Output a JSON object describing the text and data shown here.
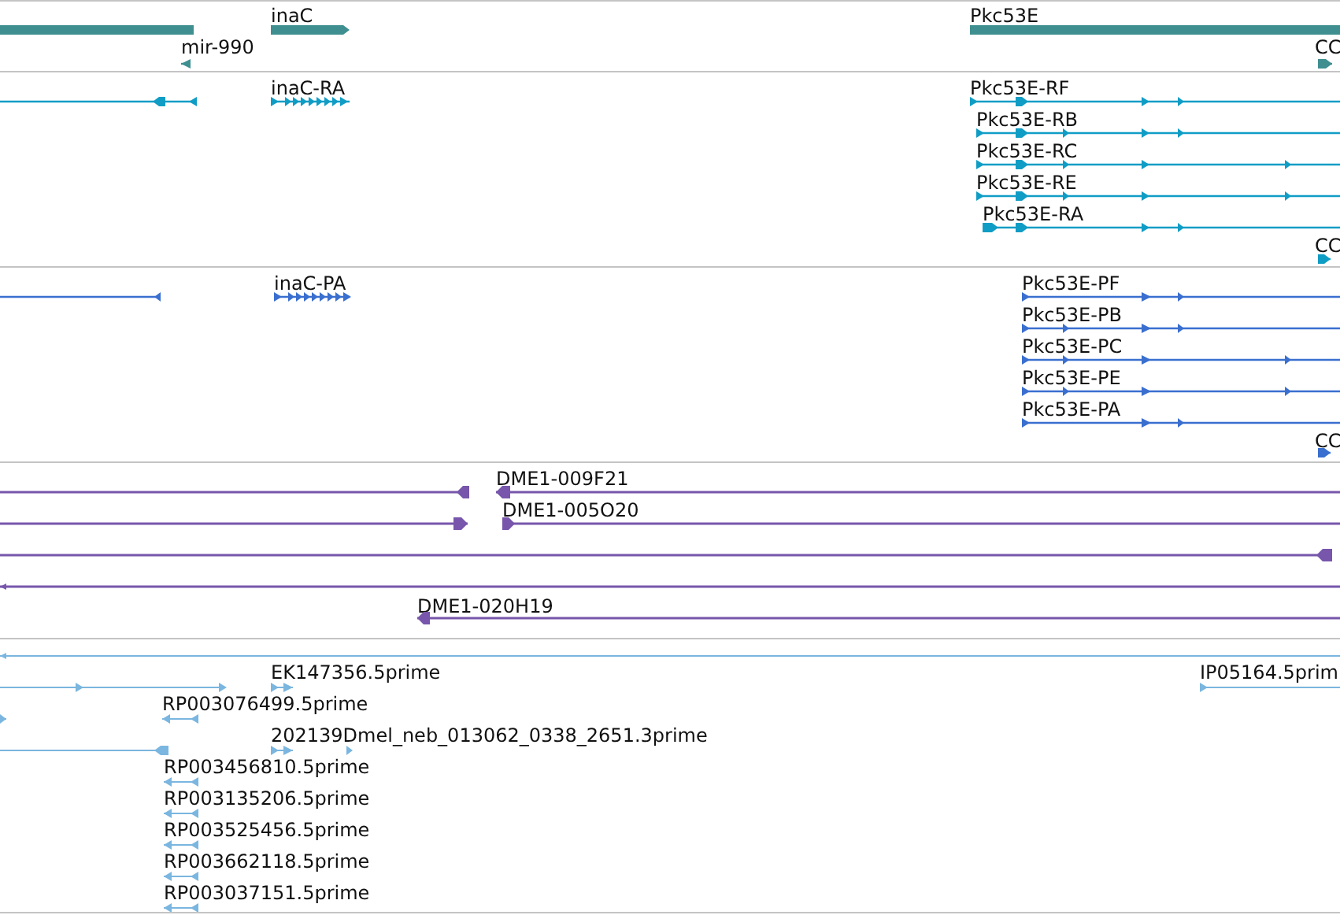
{
  "tracks": [
    {
      "kind": "gene",
      "color": "#3f8f91",
      "features": [
        {
          "reverse": true
        },
        {
          "label": "inaC",
          "reverse": false
        },
        {
          "label": "mir-990",
          "reverse": true
        },
        {
          "label": "Pkc53E",
          "reverse": false
        },
        {
          "label": "CC",
          "reverse": false
        }
      ]
    },
    {
      "kind": "transcript",
      "color": "#109dc5",
      "features": [
        {
          "reverse": true
        },
        {
          "label": "inaC-RA",
          "reverse": false
        },
        {
          "label": "Pkc53E-RF",
          "reverse": false
        },
        {
          "label": "Pkc53E-RB",
          "reverse": false
        },
        {
          "label": "Pkc53E-RC",
          "reverse": false
        },
        {
          "label": "Pkc53E-RE",
          "reverse": false
        },
        {
          "label": "Pkc53E-RA",
          "reverse": false
        },
        {
          "label": "CC",
          "reverse": false
        }
      ]
    },
    {
      "kind": "protein",
      "color": "#3a6fcf",
      "features": [
        {
          "reverse": true
        },
        {
          "label": "inaC-PA",
          "reverse": false
        },
        {
          "label": "Pkc53E-PF",
          "reverse": false
        },
        {
          "label": "Pkc53E-PB",
          "reverse": false
        },
        {
          "label": "Pkc53E-PC",
          "reverse": false
        },
        {
          "label": "Pkc53E-PE",
          "reverse": false
        },
        {
          "label": "Pkc53E-PA",
          "reverse": false
        },
        {
          "label": "CC",
          "reverse": false
        }
      ]
    },
    {
      "kind": "clone",
      "color": "#7756ab",
      "features": [
        {
          "reverse": true
        },
        {
          "label": "DME1-009F21",
          "reverse": true
        },
        {
          "reverse": false
        },
        {
          "label": "DME1-005O20",
          "reverse": false
        },
        {
          "reverse": true
        },
        {
          "reverse": true
        },
        {
          "label": "DME1-020H19",
          "reverse": true
        }
      ]
    },
    {
      "kind": "est",
      "color": "#7ab6df",
      "features": [
        {
          "reverse": true
        },
        {
          "reverse": false
        },
        {
          "label": "EK147356.5prime",
          "reverse": false
        },
        {
          "label": "IP05164.5prim",
          "reverse": false
        },
        {
          "reverse": false
        },
        {
          "label": "RP003076499.5prime",
          "reverse": true
        },
        {
          "reverse": true
        },
        {
          "label": "202139Dmel_neb_013062_0338_2651.3prime",
          "reverse": false
        },
        {
          "label": "RP003456810.5prime",
          "reverse": true
        },
        {
          "label": "RP003135206.5prime",
          "reverse": true
        },
        {
          "label": "RP003525456.5prime",
          "reverse": true
        },
        {
          "label": "RP003662118.5prime",
          "reverse": true
        },
        {
          "label": "RP003037151.5prime",
          "reverse": true
        }
      ]
    }
  ]
}
